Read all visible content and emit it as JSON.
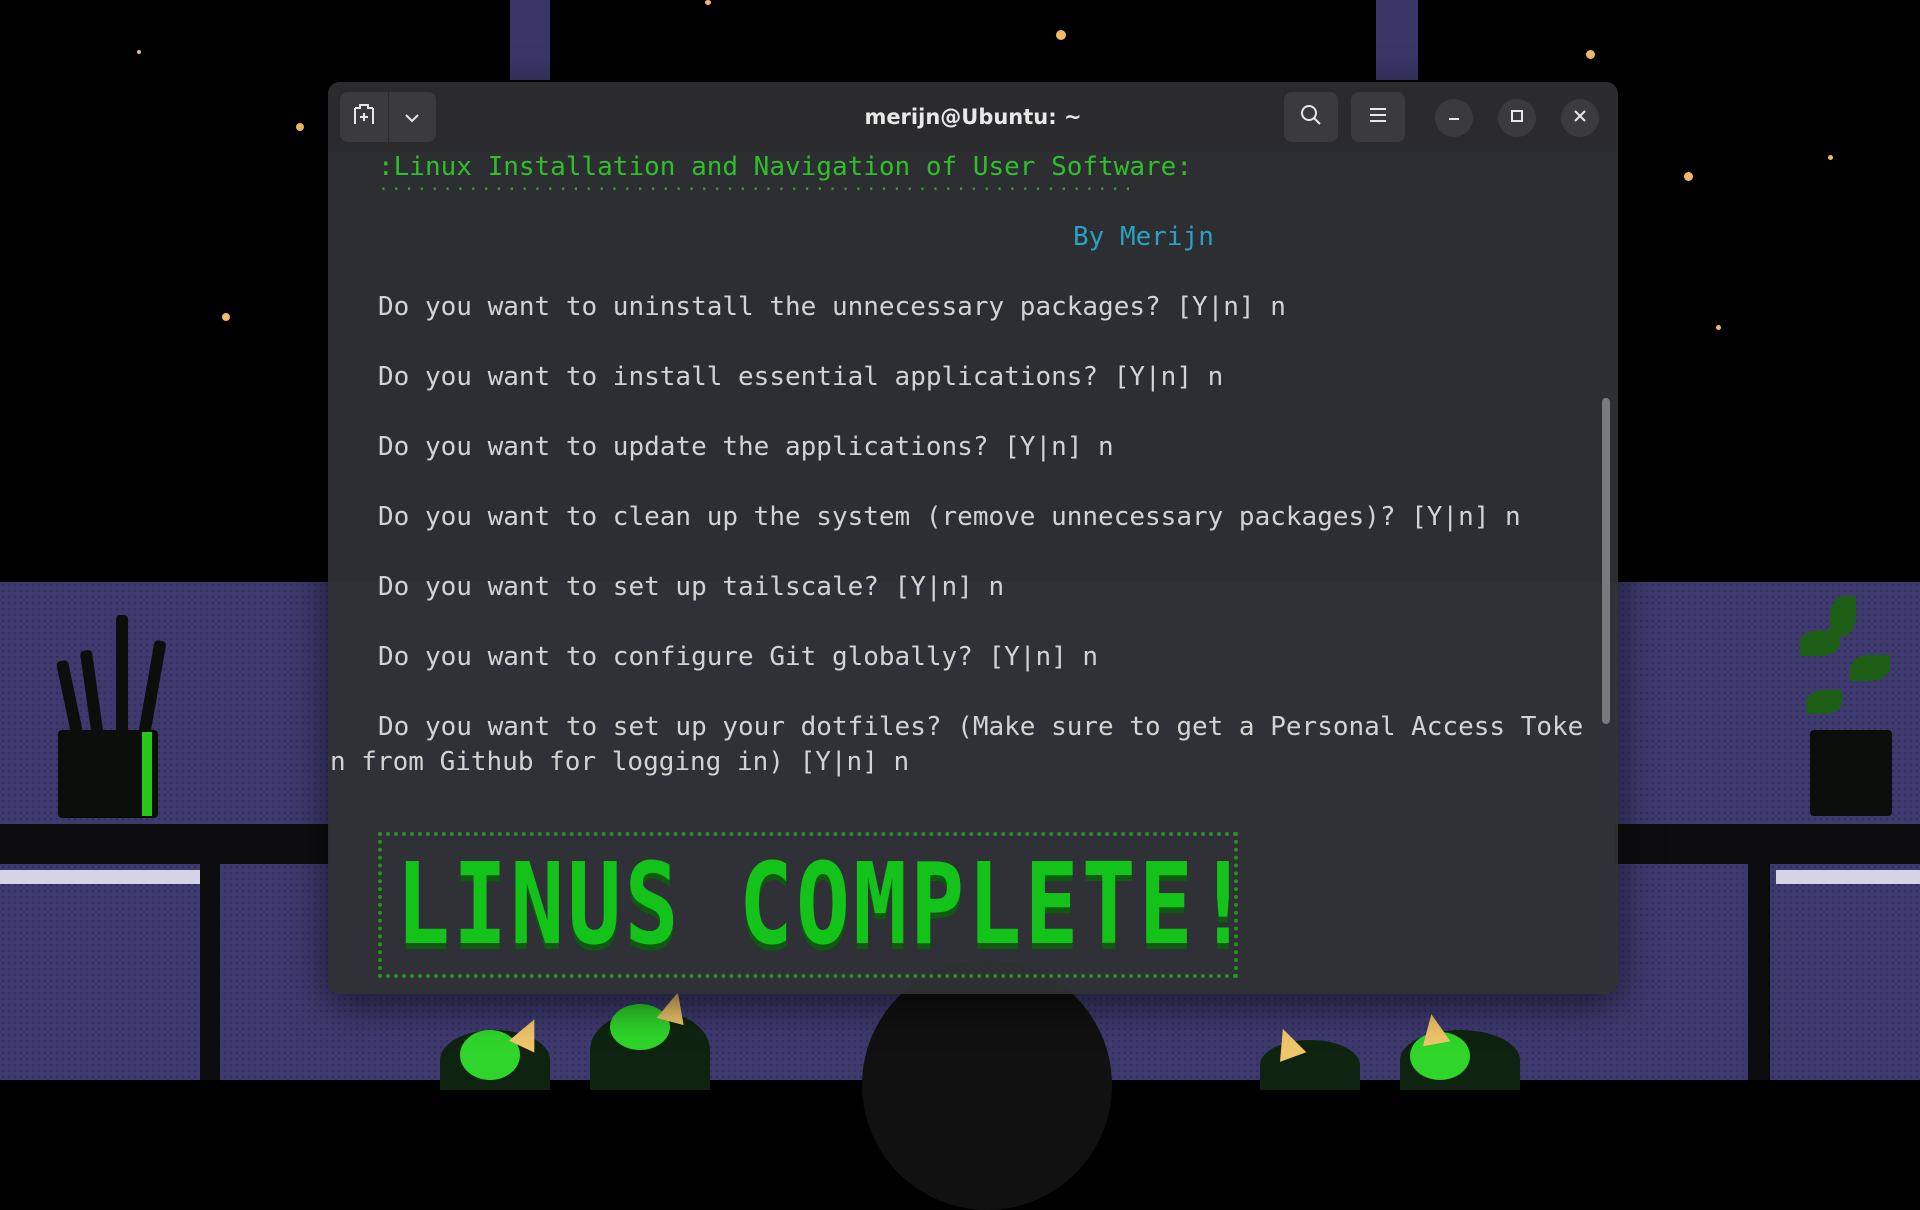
{
  "window": {
    "title": "merijn@Ubuntu: ~"
  },
  "titlebar": {
    "new_tab_icon": "new-tab-icon",
    "dropdown_icon": "chevron-down-icon",
    "search_icon": "search-icon",
    "menu_icon": "hamburger-menu-icon",
    "minimize_icon": "minimize-icon",
    "maximize_icon": "maximize-icon",
    "close_icon": "close-icon"
  },
  "terminal": {
    "header_title": ":Linux Installation and Navigation of User Software:",
    "header_dots": "...........................................................",
    "byline": "By Merijn",
    "prompts": [
      "Do you want to uninstall the unnecessary packages? [Y|n] n",
      "Do you want to install essential applications? [Y|n] n",
      "Do you want to update the applications? [Y|n] n",
      "Do you want to clean up the system (remove unnecessary packages)? [Y|n] n",
      "Do you want to set up tailscale? [Y|n] n",
      "Do you want to configure Git globally? [Y|n] n"
    ],
    "dotfiles_prompt_line1": "Do you want to set up your dotfiles? (Make sure to get a Personal Access Toke",
    "dotfiles_prompt_line2": "n from Github for logging in) [Y|n] n",
    "banner": "LINUS COMPLETE!"
  },
  "colors": {
    "accent_green": "#2fbf2a",
    "byline_cyan": "#2aa0c4",
    "terminal_text": "#d3d3d3",
    "wall_purple": "#3e3a6f"
  }
}
